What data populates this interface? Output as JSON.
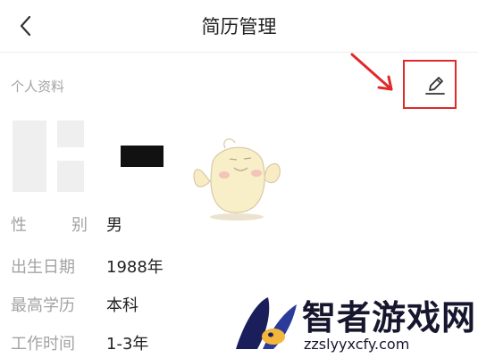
{
  "header": {
    "title": "简历管理",
    "back_icon": "chevron-left-icon"
  },
  "profile": {
    "section_label": "个人资料",
    "edit_icon": "pencil-icon",
    "annotation_color": "#e0292a",
    "rows": [
      {
        "label": "性别",
        "value": "男"
      },
      {
        "label": "出生日期",
        "value": "1988年"
      },
      {
        "label": "最高学历",
        "value": "本科"
      },
      {
        "label": "工作时间",
        "value": "1-3年"
      }
    ]
  },
  "watermark": {
    "title": "智者游戏网",
    "url": "zzslyyxcfy.com"
  }
}
